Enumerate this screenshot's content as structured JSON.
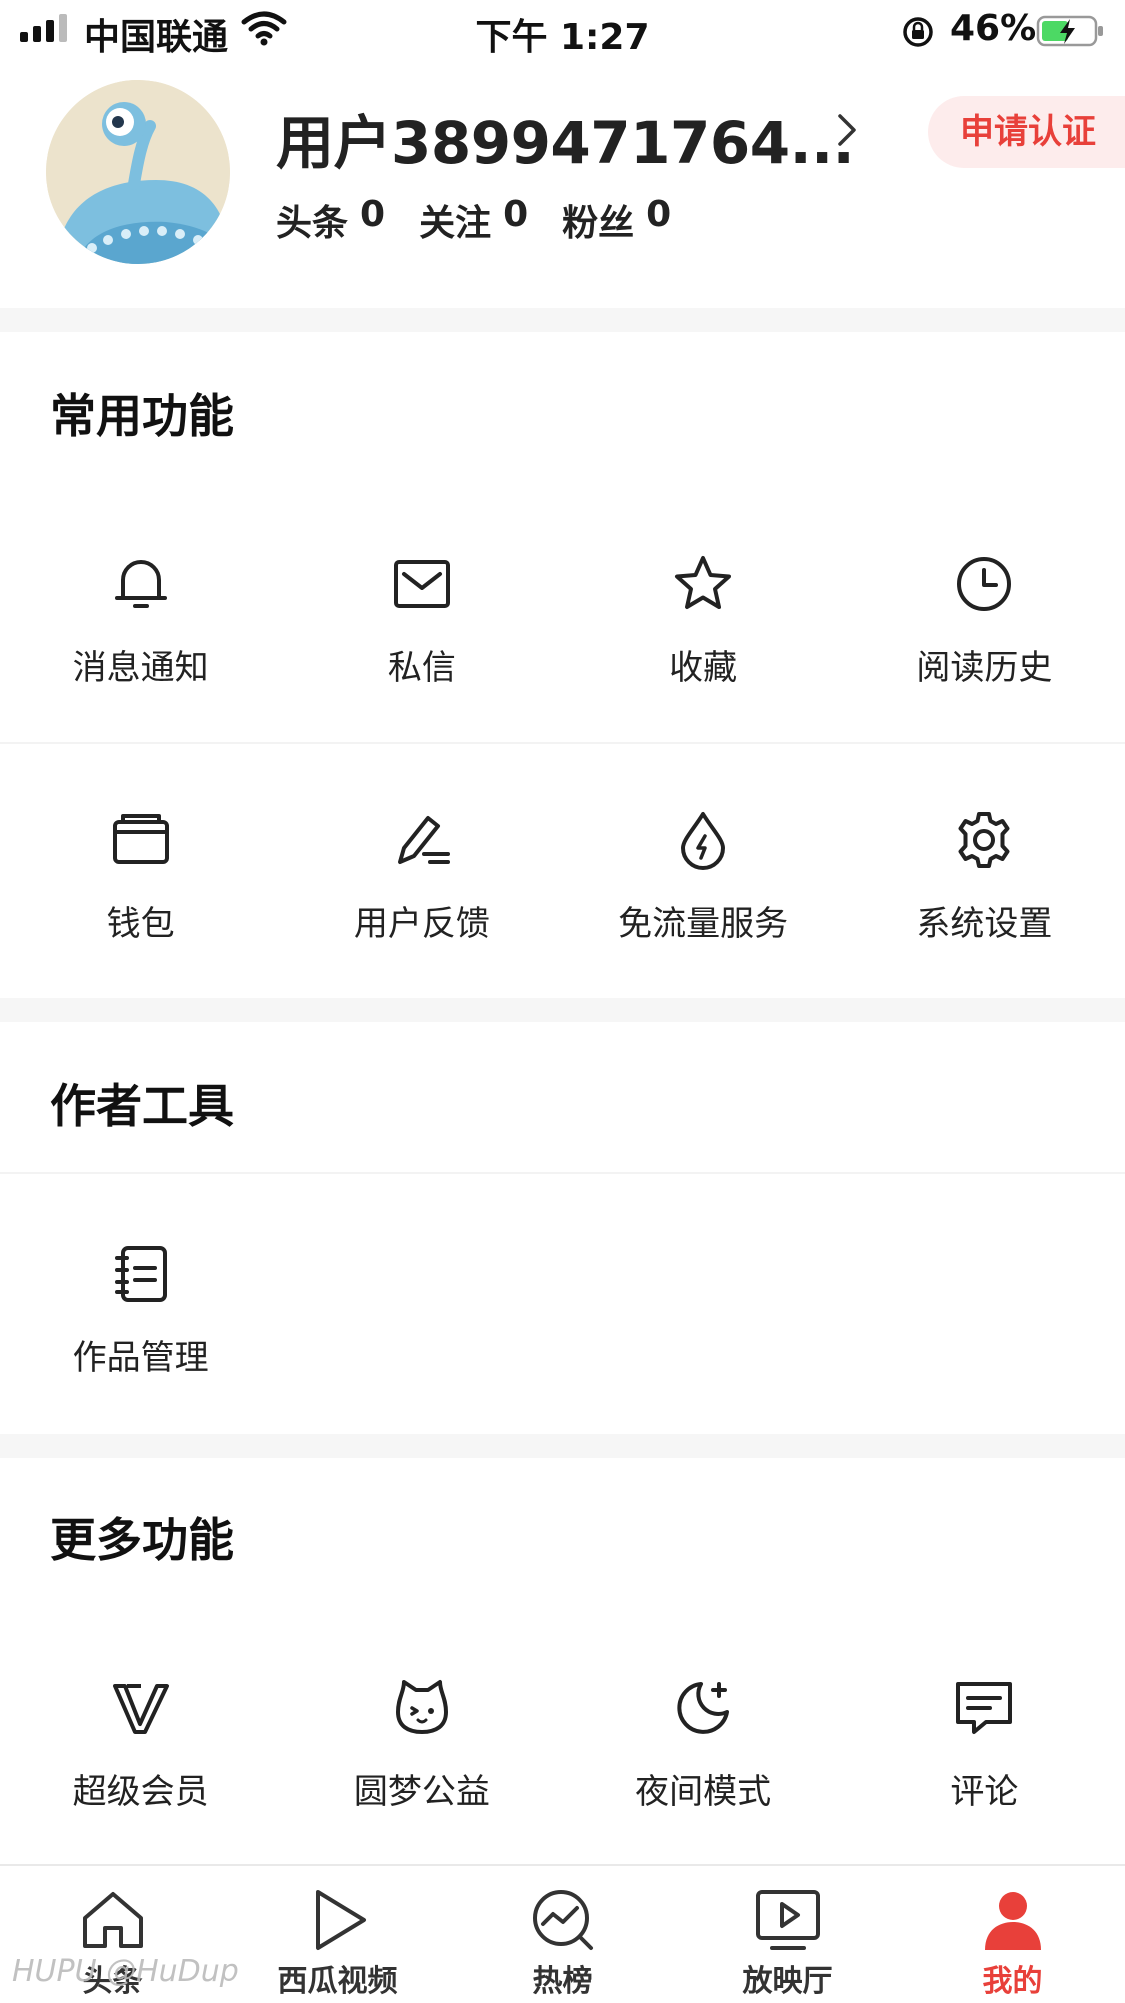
{
  "status_bar": {
    "carrier": "中国联通",
    "time": "下午 1:27",
    "battery_percent": "46%"
  },
  "profile": {
    "username": "用户3899471764...",
    "verify_button": "申请认证",
    "stats": [
      {
        "label": "头条",
        "value": "0"
      },
      {
        "label": "关注",
        "value": "0"
      },
      {
        "label": "粉丝",
        "value": "0"
      }
    ]
  },
  "sections": {
    "common": {
      "title": "常用功能",
      "items": [
        {
          "label": "消息通知",
          "icon": "bell-icon"
        },
        {
          "label": "私信",
          "icon": "envelope-icon"
        },
        {
          "label": "收藏",
          "icon": "star-icon"
        },
        {
          "label": "阅读历史",
          "icon": "clock-icon"
        },
        {
          "label": "钱包",
          "icon": "wallet-icon"
        },
        {
          "label": "用户反馈",
          "icon": "pen-icon"
        },
        {
          "label": "免流量服务",
          "icon": "drop-icon"
        },
        {
          "label": "系统设置",
          "icon": "gear-icon"
        }
      ]
    },
    "author": {
      "title": "作者工具",
      "items": [
        {
          "label": "作品管理",
          "icon": "notebook-icon"
        }
      ]
    },
    "more": {
      "title": "更多功能",
      "items": [
        {
          "label": "超级会员",
          "icon": "vip-icon"
        },
        {
          "label": "圆梦公益",
          "icon": "cat-face-icon"
        },
        {
          "label": "夜间模式",
          "icon": "moon-icon"
        },
        {
          "label": "评论",
          "icon": "comment-icon"
        }
      ]
    }
  },
  "tabbar": {
    "tabs": [
      {
        "label": "头条",
        "icon": "home-icon"
      },
      {
        "label": "西瓜视频",
        "icon": "play-icon"
      },
      {
        "label": "热榜",
        "icon": "trend-icon"
      },
      {
        "label": "放映厅",
        "icon": "tv-icon"
      },
      {
        "label": "我的",
        "icon": "person-icon",
        "active": true
      }
    ]
  },
  "watermark": "HUPU @HuDup",
  "colors": {
    "accent": "#e8403a",
    "accent_bg": "#fdecec",
    "separator": "#f6f6f6"
  }
}
